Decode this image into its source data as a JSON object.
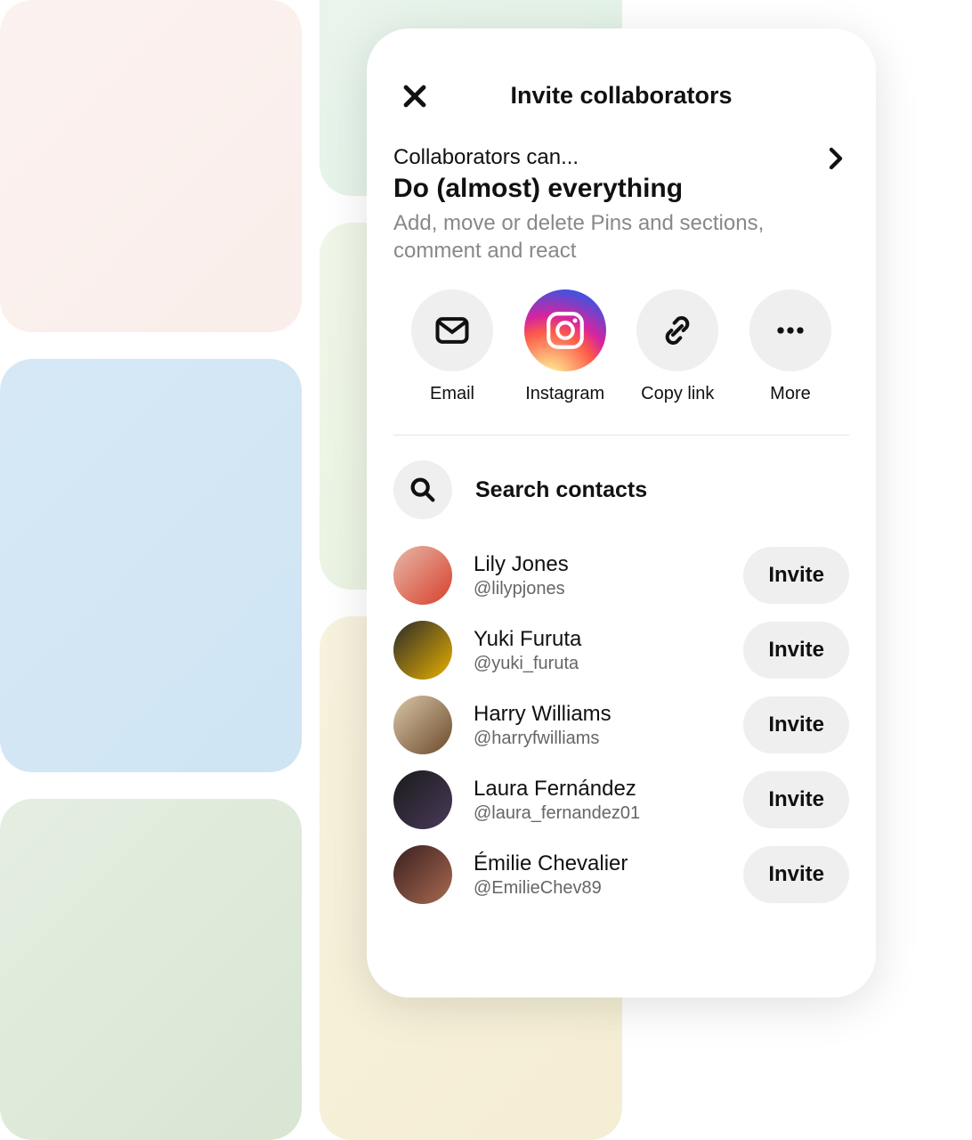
{
  "modal": {
    "title": "Invite collaborators",
    "permissions": {
      "label": "Collaborators can...",
      "title": "Do (almost) everything",
      "description": "Add, move or delete Pins and sections, comment and react"
    },
    "share": [
      {
        "label": "Email"
      },
      {
        "label": "Instagram"
      },
      {
        "label": "Copy link"
      },
      {
        "label": "More"
      }
    ],
    "search_placeholder": "Search contacts",
    "invite_label": "Invite",
    "contacts": [
      {
        "name": "Lily Jones",
        "handle": "@lilypjones"
      },
      {
        "name": "Yuki Furuta",
        "handle": "@yuki_furuta"
      },
      {
        "name": "Harry Williams",
        "handle": "@harryfwilliams"
      },
      {
        "name": "Laura Fernández",
        "handle": "@laura_fernandez01"
      },
      {
        "name": "Émilie Chevalier",
        "handle": "@EmilieChev89"
      }
    ]
  }
}
